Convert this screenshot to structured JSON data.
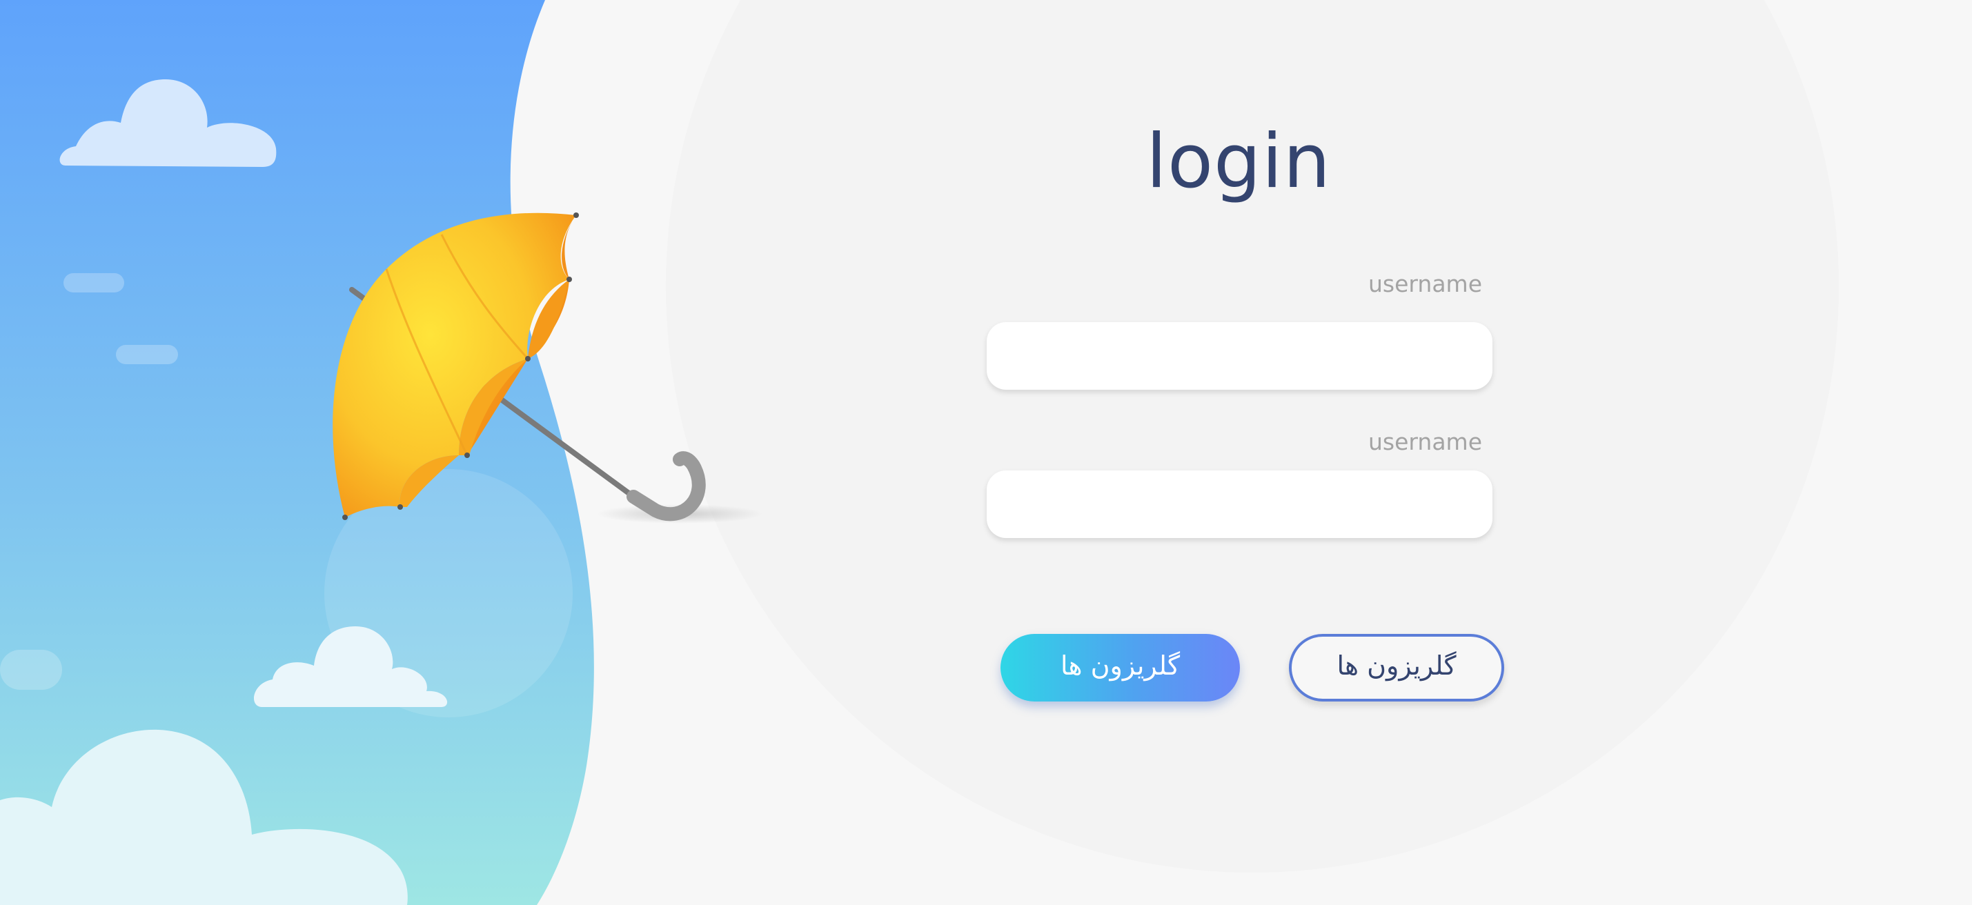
{
  "login": {
    "title": "login",
    "fields": [
      {
        "label": "username",
        "value": "",
        "placeholder": ""
      },
      {
        "label": "username",
        "value": "",
        "placeholder": ""
      }
    ],
    "buttons": {
      "primary_label": "گلریزون ها",
      "secondary_label": "گلریزون ها"
    }
  },
  "colors": {
    "title": "#34446f",
    "sky_top": "#5fa3fb",
    "sky_bottom": "#9ee6e4",
    "umbrella": "#fbc52b",
    "button_gradient_start": "#2fd6e6",
    "button_gradient_end": "#6b86f7",
    "outline_button_border": "#5b7dd8"
  },
  "icons": [
    "umbrella-illustration",
    "cloud-illustration"
  ]
}
